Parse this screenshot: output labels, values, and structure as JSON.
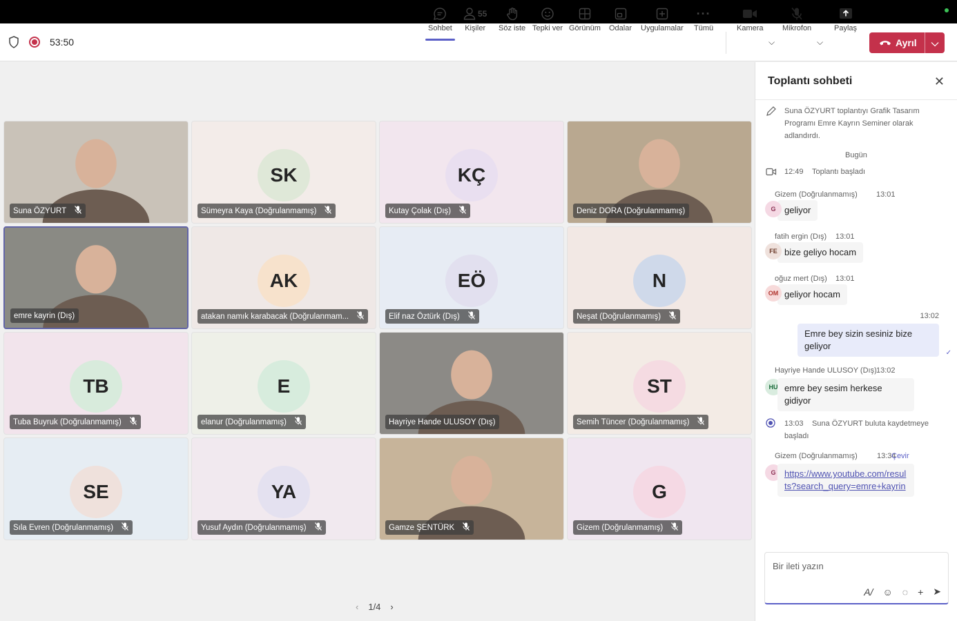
{
  "toolbar": {
    "timer": "53:50",
    "buttons": {
      "chat": "Sohbet",
      "people": "Kişiler",
      "people_count": "55",
      "raise": "Söz iste",
      "react": "Tepki ver",
      "view": "Görünüm",
      "rooms": "Odalar",
      "apps": "Uygulamalar",
      "more": "Tümü",
      "camera": "Kamera",
      "mic": "Mikrofon",
      "share": "Paylaş"
    },
    "leave": "Ayrıl"
  },
  "participants": [
    {
      "name": "Suna ÖZYURT",
      "video": true,
      "bg": "#c9c2b8"
    },
    {
      "name": "Sümeyra Kaya (Doğrulanmamış)",
      "initials": "SK",
      "tile_bg": "#f3ece9",
      "avatar_bg": "#dfe8d8"
    },
    {
      "name": "Kutay Çolak (Dış)",
      "initials": "KÇ",
      "tile_bg": "#f2e6ee",
      "avatar_bg": "#e9dff0"
    },
    {
      "name": "Deniz DORA (Doğrulanmamış)",
      "video": true,
      "bg": "#b9a890"
    },
    {
      "name": "emre kayrin (Dış)",
      "video": true,
      "bg": "#8a8a84",
      "selected": true
    },
    {
      "name": "atakan namık karabacak (Doğrulanmam...",
      "initials": "AK",
      "tile_bg": "#efe8e6",
      "avatar_bg": "#f7e2cc"
    },
    {
      "name": "Elif naz Öztürk (Dış)",
      "initials": "EÖ",
      "tile_bg": "#e7ecf4",
      "avatar_bg": "#e2e0ef"
    },
    {
      "name": "Neşat (Doğrulanmamış)",
      "initials": "N",
      "tile_bg": "#f2e8e4",
      "avatar_bg": "#cfd9ea"
    },
    {
      "name": "Tuba Buyruk (Doğrulanmamış)",
      "initials": "TB",
      "tile_bg": "#f2e4ec",
      "avatar_bg": "#d8ebdc"
    },
    {
      "name": "elanur (Doğrulanmamış)",
      "initials": "E",
      "tile_bg": "#eef0e8",
      "avatar_bg": "#d7ecdd"
    },
    {
      "name": "Hayriye Hande ULUSOY (Dış)",
      "video": true,
      "bg": "#8c8a86"
    },
    {
      "name": "Semih Tüncer (Doğrulanmamış)",
      "initials": "ST",
      "tile_bg": "#f3ebe5",
      "avatar_bg": "#f5dbe2"
    },
    {
      "name": "Sıla Evren (Doğrulanmamış)",
      "initials": "SE",
      "tile_bg": "#e6edf3",
      "avatar_bg": "#efe1dc"
    },
    {
      "name": "Yusuf Aydın (Doğrulanmamış)",
      "initials": "YA",
      "tile_bg": "#f1e9ef",
      "avatar_bg": "#e4e1f0"
    },
    {
      "name": "Gamze ŞENTÜRK",
      "video": true,
      "bg": "#c7b49a"
    },
    {
      "name": "Gizem (Doğrulanmamış)",
      "initials": "G",
      "tile_bg": "#f0e6f0",
      "avatar_bg": "#f5d9e4"
    }
  ],
  "pager": "1/4",
  "chat": {
    "title": "Toplantı sohbeti",
    "rename_event": "Suna ÖZYURT toplantıyı Grafik Tasarım Programı Emre Kayrın Seminer olarak adlandırdı.",
    "day": "Bugün",
    "meeting_start_time": "12:49",
    "meeting_start_text": "Toplantı başladı",
    "messages": [
      {
        "sender": "Gizem (Doğrulanmamış)",
        "time": "13:01",
        "initials": "G",
        "text": "geliyor"
      },
      {
        "sender": "fatih ergin (Dış)",
        "time": "13:01",
        "initials": "FE",
        "text": "bize geliyo hocam"
      },
      {
        "sender": "oğuz mert (Dış)",
        "time": "13:01",
        "initials": "OM",
        "text": "geliyor hocam"
      }
    ],
    "mine": {
      "time": "13:02",
      "text": "Emre bey sizin sesiniz bize geliyor"
    },
    "hu_msg": {
      "sender": "Hayriye Hande ULUSOY (Dış)",
      "time": "13:02",
      "initials": "HU",
      "text": "emre bey sesim herkese gidiyor"
    },
    "record_time": "13:03",
    "record_text": "Suna ÖZYURT buluta kaydetmeye başladı",
    "link_msg": {
      "sender": "Gizem (Doğrulanmamış)",
      "time": "13:34",
      "translate": "Çevir",
      "initials": "G",
      "link": "https://www.youtube.com/results?search_query=emre+kayrin"
    },
    "compose_placeholder": "Bir ileti yazın"
  }
}
